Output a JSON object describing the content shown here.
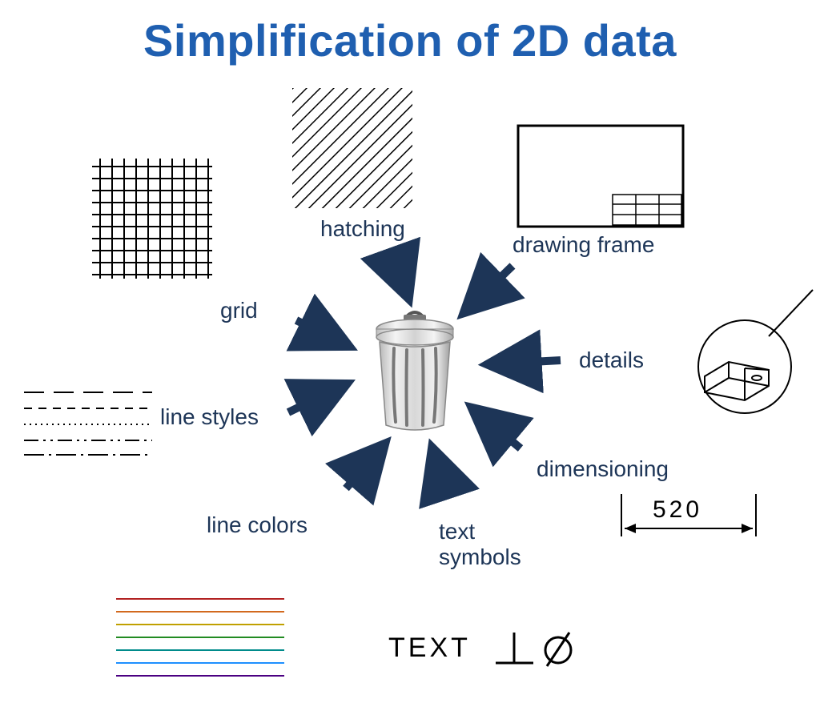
{
  "title": "Simplification of 2D data",
  "labels": {
    "hatching": "hatching",
    "drawing_frame": "drawing frame",
    "grid": "grid",
    "details": "details",
    "line_styles": "line styles",
    "dimensioning": "dimensioning",
    "line_colors": "line colors",
    "text_symbols": "text\nsymbols"
  },
  "dimension_value": "520",
  "text_symbol_sample": "TEXT",
  "colors": {
    "title": "#1f5fb0",
    "label": "#1d3557",
    "arrow": "#1d3557"
  },
  "line_color_swatch": [
    "#b22222",
    "#d2691e",
    "#c0a000",
    "#228b22",
    "#008b8b",
    "#1e90ff",
    "#4b0082"
  ]
}
